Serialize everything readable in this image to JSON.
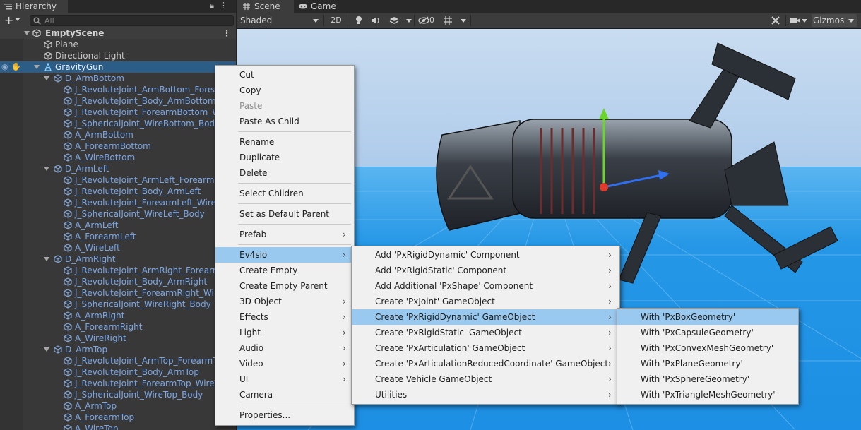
{
  "hierarchy": {
    "tab_label": "Hierarchy",
    "search_placeholder": "All",
    "scene_name": "EmptyScene",
    "rows": [
      {
        "label": "Plane",
        "depth": 1,
        "color": "white",
        "fold": false
      },
      {
        "label": "Directional Light",
        "depth": 1,
        "color": "white",
        "fold": false
      },
      {
        "label": "GravityGun",
        "depth": 1,
        "color": "selected",
        "fold": true
      },
      {
        "label": "D_ArmBottom",
        "depth": 2,
        "color": "blue",
        "fold": true
      },
      {
        "label": "J_RevoluteJoint_ArmBottom_ForearmBottom",
        "depth": 3,
        "color": "blue",
        "fold": false
      },
      {
        "label": "J_RevoluteJoint_Body_ArmBottom",
        "depth": 3,
        "color": "blue",
        "fold": false
      },
      {
        "label": "J_RevoluteJoint_ForearmBottom_WireBottom",
        "depth": 3,
        "color": "blue",
        "fold": false
      },
      {
        "label": "J_SphericalJoint_WireBottom_Body",
        "depth": 3,
        "color": "blue",
        "fold": false
      },
      {
        "label": "A_ArmBottom",
        "depth": 3,
        "color": "blue",
        "fold": false
      },
      {
        "label": "A_ForearmBottom",
        "depth": 3,
        "color": "blue",
        "fold": false
      },
      {
        "label": "A_WireBottom",
        "depth": 3,
        "color": "blue",
        "fold": false
      },
      {
        "label": "D_ArmLeft",
        "depth": 2,
        "color": "blue",
        "fold": true
      },
      {
        "label": "J_RevoluteJoint_ArmLeft_ForearmLeft",
        "depth": 3,
        "color": "blue",
        "fold": false
      },
      {
        "label": "J_RevoluteJoint_Body_ArmLeft",
        "depth": 3,
        "color": "blue",
        "fold": false
      },
      {
        "label": "J_RevoluteJoint_ForearmLeft_WireLeft",
        "depth": 3,
        "color": "blue",
        "fold": false
      },
      {
        "label": "J_SphericalJoint_WireLeft_Body",
        "depth": 3,
        "color": "blue",
        "fold": false
      },
      {
        "label": "A_ArmLeft",
        "depth": 3,
        "color": "blue",
        "fold": false
      },
      {
        "label": "A_ForearmLeft",
        "depth": 3,
        "color": "blue",
        "fold": false
      },
      {
        "label": "A_WireLeft",
        "depth": 3,
        "color": "blue",
        "fold": false
      },
      {
        "label": "D_ArmRight",
        "depth": 2,
        "color": "blue",
        "fold": true
      },
      {
        "label": "J_RevoluteJoint_ArmRight_ForearmRight",
        "depth": 3,
        "color": "blue",
        "fold": false
      },
      {
        "label": "J_RevoluteJoint_Body_ArmRight",
        "depth": 3,
        "color": "blue",
        "fold": false
      },
      {
        "label": "J_RevoluteJoint_ForearmRight_WireRight",
        "depth": 3,
        "color": "blue",
        "fold": false
      },
      {
        "label": "J_SphericalJoint_WireRight_Body",
        "depth": 3,
        "color": "blue",
        "fold": false
      },
      {
        "label": "A_ArmRight",
        "depth": 3,
        "color": "blue",
        "fold": false
      },
      {
        "label": "A_ForearmRight",
        "depth": 3,
        "color": "blue",
        "fold": false
      },
      {
        "label": "A_WireRight",
        "depth": 3,
        "color": "blue",
        "fold": false
      },
      {
        "label": "D_ArmTop",
        "depth": 2,
        "color": "blue",
        "fold": true
      },
      {
        "label": "J_RevoluteJoint_ArmTop_ForearmTop",
        "depth": 3,
        "color": "blue",
        "fold": false
      },
      {
        "label": "J_RevoluteJoint_Body_ArmTop",
        "depth": 3,
        "color": "blue",
        "fold": false
      },
      {
        "label": "J_RevoluteJoint_ForearmTop_WireTop",
        "depth": 3,
        "color": "blue",
        "fold": false
      },
      {
        "label": "J_SphericalJoint_WireTop_Body",
        "depth": 3,
        "color": "blue",
        "fold": false
      },
      {
        "label": "A_ArmTop",
        "depth": 3,
        "color": "blue",
        "fold": false
      },
      {
        "label": "A_ForearmTop",
        "depth": 3,
        "color": "blue",
        "fold": false
      },
      {
        "label": "A_WireTop",
        "depth": 3,
        "color": "blue",
        "fold": false
      }
    ]
  },
  "scene": {
    "tab_scene": "Scene",
    "tab_game": "Game",
    "draw_mode": "Shaded",
    "btn_2d": "2D",
    "hidden_count": "0",
    "gizmos_label": "Gizmos"
  },
  "context_menu": {
    "items": [
      {
        "label": "Cut",
        "submenu": false,
        "disabled": false
      },
      {
        "label": "Copy",
        "submenu": false,
        "disabled": false
      },
      {
        "label": "Paste",
        "submenu": false,
        "disabled": true
      },
      {
        "label": "Paste As Child",
        "submenu": false,
        "disabled": false,
        "sep_after": true
      },
      {
        "label": "Rename",
        "submenu": false,
        "disabled": false
      },
      {
        "label": "Duplicate",
        "submenu": false,
        "disabled": false
      },
      {
        "label": "Delete",
        "submenu": false,
        "disabled": false,
        "sep_after": true
      },
      {
        "label": "Select Children",
        "submenu": false,
        "disabled": false,
        "sep_after": true
      },
      {
        "label": "Set as Default Parent",
        "submenu": false,
        "disabled": false,
        "sep_after": true
      },
      {
        "label": "Prefab",
        "submenu": true,
        "disabled": false,
        "sep_after": true
      },
      {
        "label": "Ev4sio",
        "submenu": true,
        "disabled": false,
        "highlighted": true
      },
      {
        "label": "Create Empty",
        "submenu": false,
        "disabled": false
      },
      {
        "label": "Create Empty Parent",
        "submenu": false,
        "disabled": false
      },
      {
        "label": "3D Object",
        "submenu": true,
        "disabled": false
      },
      {
        "label": "Effects",
        "submenu": true,
        "disabled": false
      },
      {
        "label": "Light",
        "submenu": true,
        "disabled": false
      },
      {
        "label": "Audio",
        "submenu": true,
        "disabled": false
      },
      {
        "label": "Video",
        "submenu": true,
        "disabled": false
      },
      {
        "label": "UI",
        "submenu": true,
        "disabled": false
      },
      {
        "label": "Camera",
        "submenu": false,
        "disabled": false,
        "sep_after": true
      },
      {
        "label": "Properties...",
        "submenu": false,
        "disabled": false
      }
    ]
  },
  "ev4sio_menu": {
    "items": [
      {
        "label": "Add 'PxRigidDynamic' Component",
        "submenu": true
      },
      {
        "label": "Add 'PxRigidStatic' Component",
        "submenu": true
      },
      {
        "label": "Add Additional 'PxShape' Component",
        "submenu": true
      },
      {
        "label": "Create 'PxJoint' GameObject",
        "submenu": true
      },
      {
        "label": "Create 'PxRigidDynamic' GameObject",
        "submenu": true,
        "highlighted": true
      },
      {
        "label": "Create 'PxRigidStatic' GameObject",
        "submenu": true
      },
      {
        "label": "Create 'PxArticulation' GameObject",
        "submenu": true
      },
      {
        "label": "Create 'PxArticulationReducedCoordinate' GameObject",
        "submenu": true
      },
      {
        "label": "Create Vehicle GameObject",
        "submenu": true
      },
      {
        "label": "Utilities",
        "submenu": true
      }
    ]
  },
  "geometry_menu": {
    "items": [
      {
        "label": "With 'PxBoxGeometry'",
        "highlighted": true
      },
      {
        "label": "With 'PxCapsuleGeometry'"
      },
      {
        "label": "With 'PxConvexMeshGeometry'"
      },
      {
        "label": "With 'PxPlaneGeometry'"
      },
      {
        "label": "With 'PxSphereGeometry'"
      },
      {
        "label": "With 'PxTriangleMeshGeometry'"
      }
    ]
  }
}
